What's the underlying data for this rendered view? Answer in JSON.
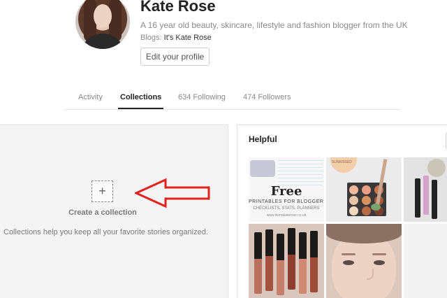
{
  "profile": {
    "name": "Kate Rose",
    "bio": "A 16 year old beauty, skincare, lifestyle and fashion blogger from the UK",
    "blogs_label": "Blogs:",
    "blog_link": "It's Kate Rose",
    "edit_button": "Edit your profile"
  },
  "tabs": [
    {
      "label": "Activity",
      "active": false
    },
    {
      "label": "Collections",
      "active": true
    },
    {
      "label": "634 Following",
      "active": false
    },
    {
      "label": "474 Followers",
      "active": false
    }
  ],
  "collections": {
    "add_icon": "plus-icon",
    "add_symbol": "+",
    "create_label": "Create a collection",
    "help_text": "Collections help you keep all your favorite stories organized."
  },
  "annotation": {
    "arrow_color": "#e0231f",
    "arrow_direction": "left"
  },
  "helpful": {
    "title": "Helpful",
    "tiles": [
      {
        "name": "printables-tile",
        "heading": "Free",
        "line1": "PRINTABLES FOR BLOGGERS",
        "line2": "CHECKLISTS, STATS, PLANNERS",
        "line3": "www.itsmekaterose.co.uk"
      },
      {
        "name": "palette-tile",
        "label": "SUNKISSED"
      },
      {
        "name": "cosmetics-tile"
      },
      {
        "name": "lipsticks-tile"
      },
      {
        "name": "model-face-tile"
      },
      {
        "name": "blank-tile"
      }
    ]
  }
}
